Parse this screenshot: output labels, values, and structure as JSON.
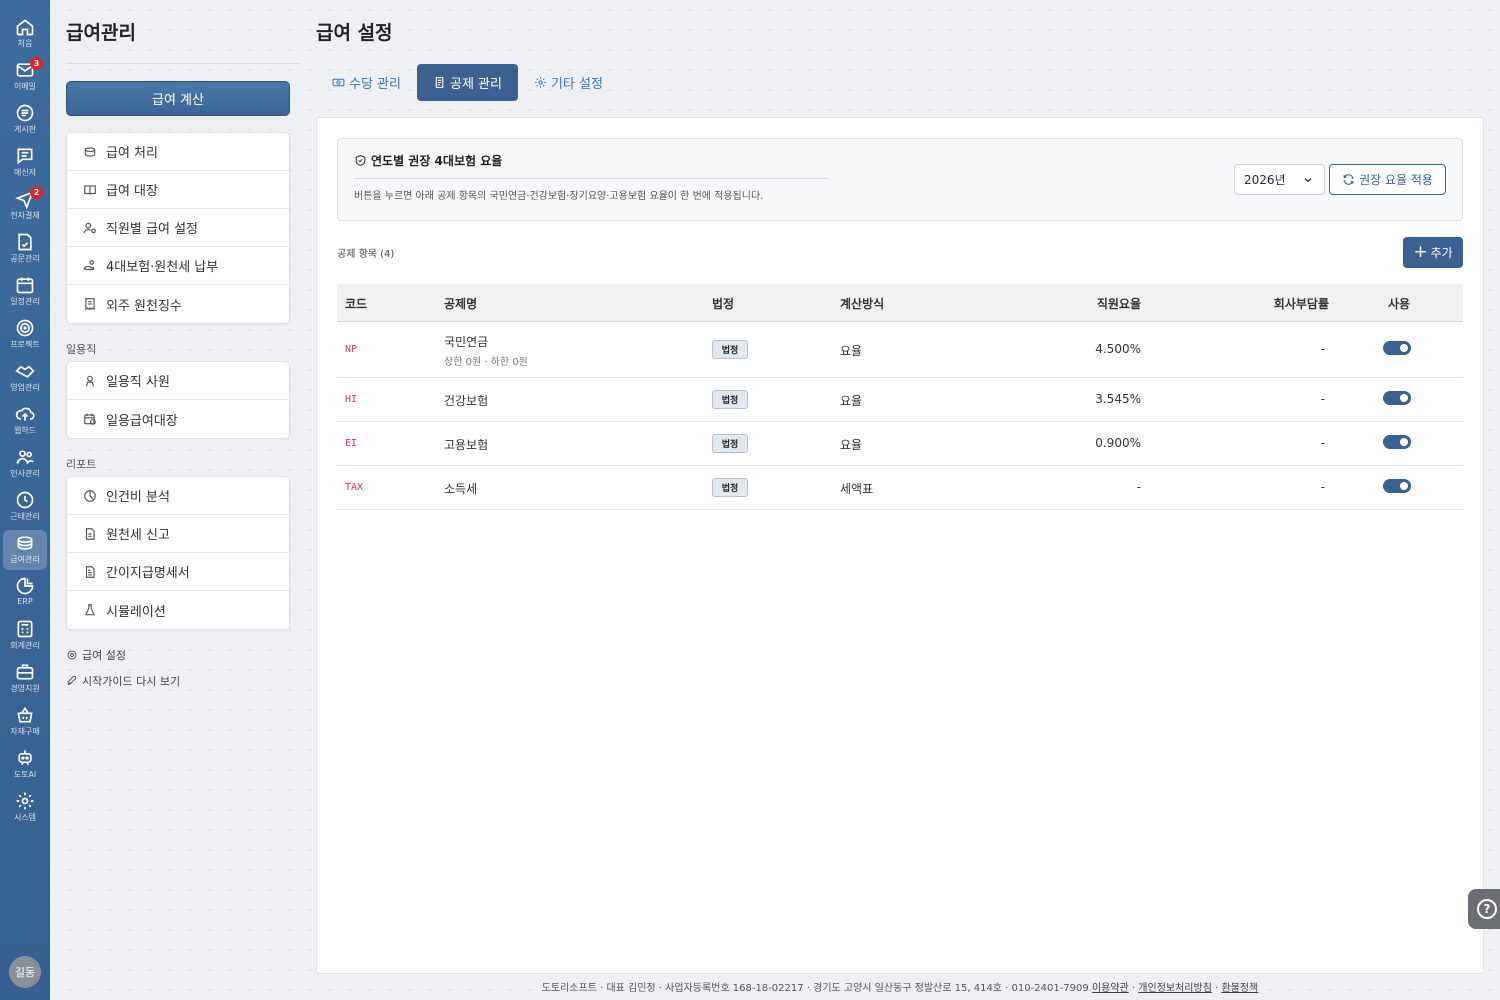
{
  "rail": {
    "items": [
      {
        "label": "처음",
        "icon": "home-icon"
      },
      {
        "label": "이메일",
        "icon": "mail-icon",
        "badge": "3"
      },
      {
        "label": "게시판",
        "icon": "board-icon"
      },
      {
        "label": "메신저",
        "icon": "messenger-icon"
      },
      {
        "label": "전자결재",
        "icon": "approval-icon",
        "badge": "2"
      },
      {
        "label": "공문관리",
        "icon": "document-icon"
      },
      {
        "label": "일정관리",
        "icon": "calendar-icon"
      },
      {
        "label": "프로젝트",
        "icon": "target-icon"
      },
      {
        "label": "영업관리",
        "icon": "handshake-icon"
      },
      {
        "label": "웹하드",
        "icon": "cloud-upload-icon"
      },
      {
        "label": "인사관리",
        "icon": "people-icon"
      },
      {
        "label": "근태관리",
        "icon": "clock-icon"
      },
      {
        "label": "급여관리",
        "icon": "coins-icon",
        "active": true
      },
      {
        "label": "ERP",
        "icon": "pie-chart-icon"
      },
      {
        "label": "회계관리",
        "icon": "calculator-icon"
      },
      {
        "label": "경영지원",
        "icon": "briefcase-icon"
      },
      {
        "label": "자재구매",
        "icon": "basket-icon"
      },
      {
        "label": "도토AI",
        "icon": "robot-icon"
      },
      {
        "label": "시스템",
        "icon": "gear-icon"
      }
    ],
    "avatar": "길동"
  },
  "sidebar": {
    "title": "급여관리",
    "calc_button": "급여 계산",
    "main_items": [
      {
        "label": "급여 처리",
        "icon": "coins-icon"
      },
      {
        "label": "급여 대장",
        "icon": "book-icon"
      },
      {
        "label": "직원별 급여 설정",
        "icon": "user-gear-icon"
      },
      {
        "label": "4대보험·원천세 납부",
        "icon": "hand-coins-icon"
      },
      {
        "label": "외주 원천징수",
        "icon": "receipt-icon"
      }
    ],
    "daily_section": "일용직",
    "daily_items": [
      {
        "label": "일용직 사원",
        "icon": "person-icon"
      },
      {
        "label": "일용급여대장",
        "icon": "calendar-money-icon"
      }
    ],
    "report_section": "리포트",
    "report_items": [
      {
        "label": "인건비 분석",
        "icon": "pie-icon"
      },
      {
        "label": "원천세 신고",
        "icon": "file-icon"
      },
      {
        "label": "간이지급명세서",
        "icon": "file-text-icon"
      },
      {
        "label": "시뮬레이션",
        "icon": "flask-icon"
      }
    ],
    "settings_link": "급여 설정",
    "guide_link": "시작가이드 다시 보기"
  },
  "main": {
    "title": "급여 설정",
    "tabs": [
      {
        "label": "수당 관리",
        "icon": "money-icon"
      },
      {
        "label": "공제 관리",
        "icon": "receipt-icon",
        "active": true
      },
      {
        "label": "기타 설정",
        "icon": "gear-icon"
      }
    ],
    "notice": {
      "title": "연도별 권장 4대보험 요율",
      "desc": "버튼을 누르면 아래 공제 항목의 국민연금·건강보험·장기요양·고용보험 요율이 한 번에 적용됩니다."
    },
    "year_select": "2026년",
    "apply_button": "권장 요율 적용",
    "list_label": "공제 항목 (4)",
    "add_button": "추가",
    "table": {
      "headers": [
        "코드",
        "공제명",
        "법정",
        "계산방식",
        "직원요율",
        "회사부담률",
        "사용"
      ],
      "rows": [
        {
          "code": "NP",
          "name": "국민연금",
          "sub": "상한 0원 · 하한 0원",
          "legal": "법정",
          "method": "요율",
          "emp_rate": "4.500%",
          "comp_rate": "-",
          "enabled": true
        },
        {
          "code": "HI",
          "name": "건강보험",
          "sub": "",
          "legal": "법정",
          "method": "요율",
          "emp_rate": "3.545%",
          "comp_rate": "-",
          "enabled": true
        },
        {
          "code": "EI",
          "name": "고용보험",
          "sub": "",
          "legal": "법정",
          "method": "요율",
          "emp_rate": "0.900%",
          "comp_rate": "-",
          "enabled": true
        },
        {
          "code": "TAX",
          "name": "소득세",
          "sub": "",
          "legal": "법정",
          "method": "세액표",
          "emp_rate": "-",
          "comp_rate": "-",
          "enabled": true
        }
      ]
    }
  },
  "footer": {
    "text": "도토리소프트 · 대표 김민정 · 사업자등록번호 168-18-02217 · 경기도 고양시 일산동구 정발산로 15, 414호 · 010-2401-7909",
    "terms": "이용약관",
    "privacy": "개인정보처리방침",
    "refund": "환불정책",
    "sep": " · "
  },
  "colors": {
    "rail": "#3e6a9e",
    "accent": "#3b6191",
    "code": "#d6336c"
  }
}
